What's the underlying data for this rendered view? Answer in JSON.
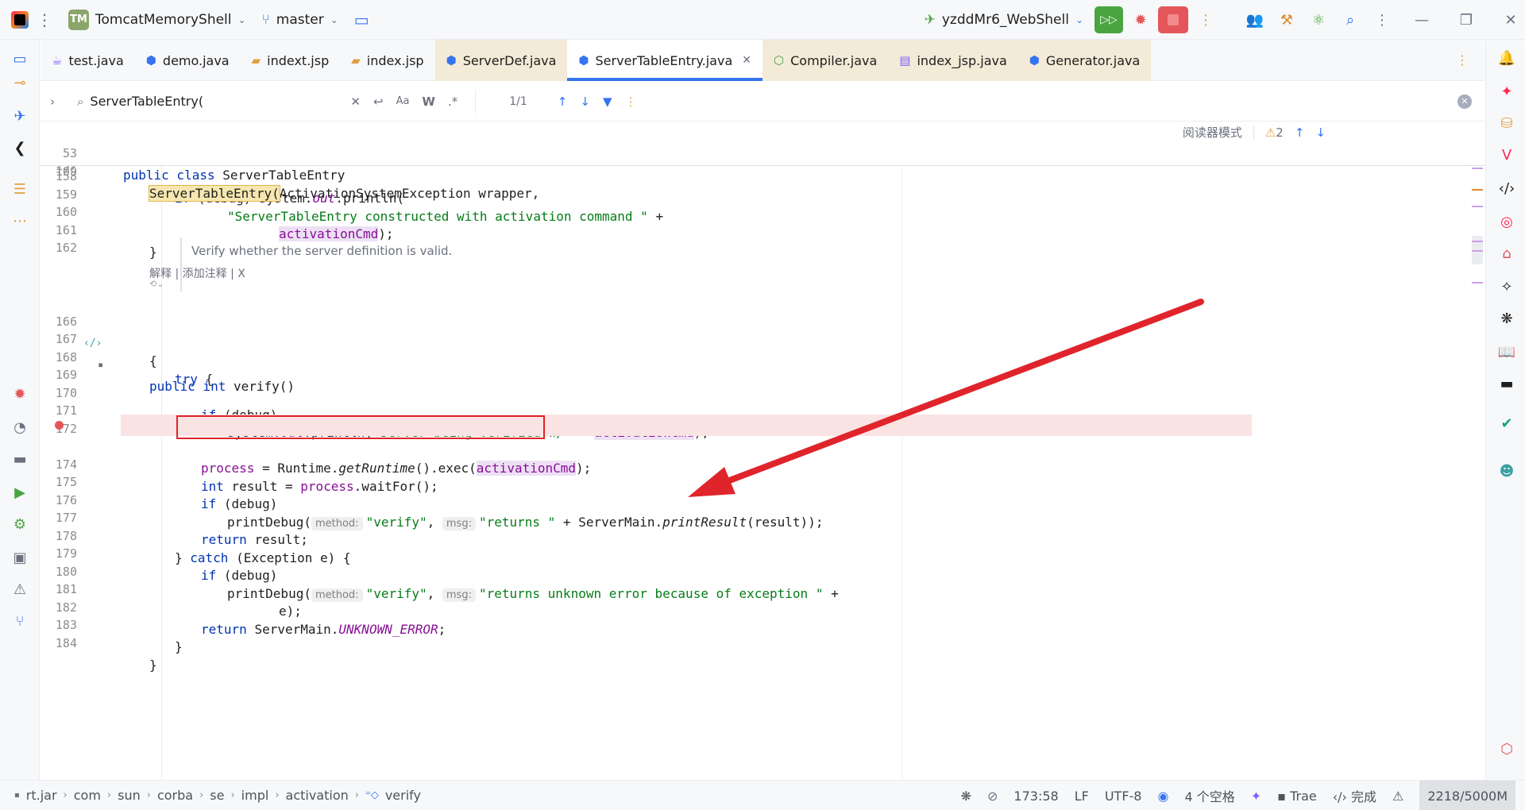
{
  "titlebar": {
    "project_badge": "TM",
    "project_name": "TomcatMemoryShell",
    "branch": "master",
    "run_config": "yzddMr6_WebShell"
  },
  "tabs": [
    {
      "label": "test.java",
      "icon": "java-file-icon"
    },
    {
      "label": "demo.java",
      "icon": "class-file-icon"
    },
    {
      "label": "indext.jsp",
      "icon": "jsp-file-icon"
    },
    {
      "label": "index.jsp",
      "icon": "jsp-file-icon"
    },
    {
      "label": "ServerDef.java",
      "icon": "class-file-icon"
    },
    {
      "label": "ServerTableEntry.java",
      "icon": "class-file-icon"
    },
    {
      "label": "Compiler.java",
      "icon": "interface-file-icon"
    },
    {
      "label": "index_jsp.java",
      "icon": "java-file-icon"
    },
    {
      "label": "Generator.java",
      "icon": "class-file-icon"
    }
  ],
  "search": {
    "query": "ServerTableEntry(",
    "count": "1/1",
    "match_case": "Aa",
    "whole_word": "W",
    "regex": ".*"
  },
  "editor": {
    "reader_mode": "阅读器模式",
    "warnings": "2",
    "sticky": [
      {
        "ln": "53",
        "t1": "public class ",
        "t2": "ServerTableEntry"
      },
      {
        "ln": "109",
        "t1": "ServerTableEntry(",
        "t2": "ActivationSystemException wrapper,"
      }
    ],
    "partial_ln": "157",
    "lines": {
      "l158": {
        "ln": "158",
        "a": "if ",
        "b": "(debug) System.",
        "c": "out",
        "d": ".println("
      },
      "l159": {
        "ln": "159",
        "a": "\"ServerTableEntry constructed with activation command \"",
        "b": " +"
      },
      "l160": {
        "ln": "160",
        "a": "activationCmd",
        "b": ");"
      },
      "l161": {
        "ln": "161",
        "a": "}"
      },
      "l162": {
        "ln": "162"
      },
      "doc": "Verify whether the server definition is valid.",
      "doc_actions": "解释 | 添加注释 | X",
      "l166": {
        "ln": "166",
        "a": "public int ",
        "b": "verify()"
      },
      "l167": {
        "ln": "167",
        "a": "{"
      },
      "l168": {
        "ln": "168",
        "a": "try",
        "b": " {"
      },
      "l169": {
        "ln": "169"
      },
      "l170": {
        "ln": "170",
        "a": "if ",
        "b": "(debug)"
      },
      "l171": {
        "ln": "171",
        "a": "System.",
        "b": "out",
        "c": ".println(",
        "d": "\"Server being verified w/\"",
        "e": " + ",
        "f": "activationCmd",
        "g": ");"
      },
      "l172": {
        "ln": "172"
      },
      "l173": {
        "a": "process",
        "b": " = Runtime.",
        "c": "getRuntime",
        "d": "().exec(",
        "e": "activationCmd",
        "f": ");"
      },
      "l174": {
        "ln": "174",
        "a": "int ",
        "b": "result = ",
        "c": "process",
        "d": ".waitFor();"
      },
      "l175": {
        "ln": "175",
        "a": "if ",
        "b": "(debug)"
      },
      "l176": {
        "ln": "176",
        "a": "printDebug(",
        "h1": "method:",
        "s1": "\"verify\"",
        "h2": "msg:",
        "s2": "\"returns \"",
        "b": " + ServerMain.",
        "c": "printResult",
        "d": "(result));"
      },
      "l177": {
        "ln": "177",
        "a": "return ",
        "b": "result;"
      },
      "l178": {
        "ln": "178",
        "a": "} ",
        "b": "catch ",
        "c": "(Exception e) {"
      },
      "l179": {
        "ln": "179",
        "a": "if ",
        "b": "(debug)"
      },
      "l180": {
        "ln": "180",
        "a": "printDebug(",
        "h1": "method:",
        "s1": "\"verify\"",
        "h2": "msg:",
        "s2": "\"returns unknown error because of exception \"",
        "b": " +"
      },
      "l181": {
        "ln": "181",
        "a": "e);"
      },
      "l182": {
        "ln": "182",
        "a": "return ",
        "b": "ServerMain.",
        "c": "UNKNOWN_ERROR",
        "d": ";"
      },
      "l183": {
        "ln": "183",
        "a": "}"
      },
      "l184": {
        "ln": "184",
        "a": "}"
      }
    }
  },
  "statusbar": {
    "breadcrumb": [
      "rt.jar",
      "com",
      "sun",
      "corba",
      "se",
      "impl",
      "activation",
      "verify"
    ],
    "position": "173:58",
    "line_sep": "LF",
    "encoding": "UTF-8",
    "indent": "4 个空格",
    "trae": "Trae",
    "done": "完成",
    "memory": "2218/5000M"
  },
  "colors": {
    "accent": "#3574f0",
    "keyword": "#0033b3",
    "string": "#067d17",
    "field": "#871094",
    "annotation_red": "#e0242b"
  }
}
